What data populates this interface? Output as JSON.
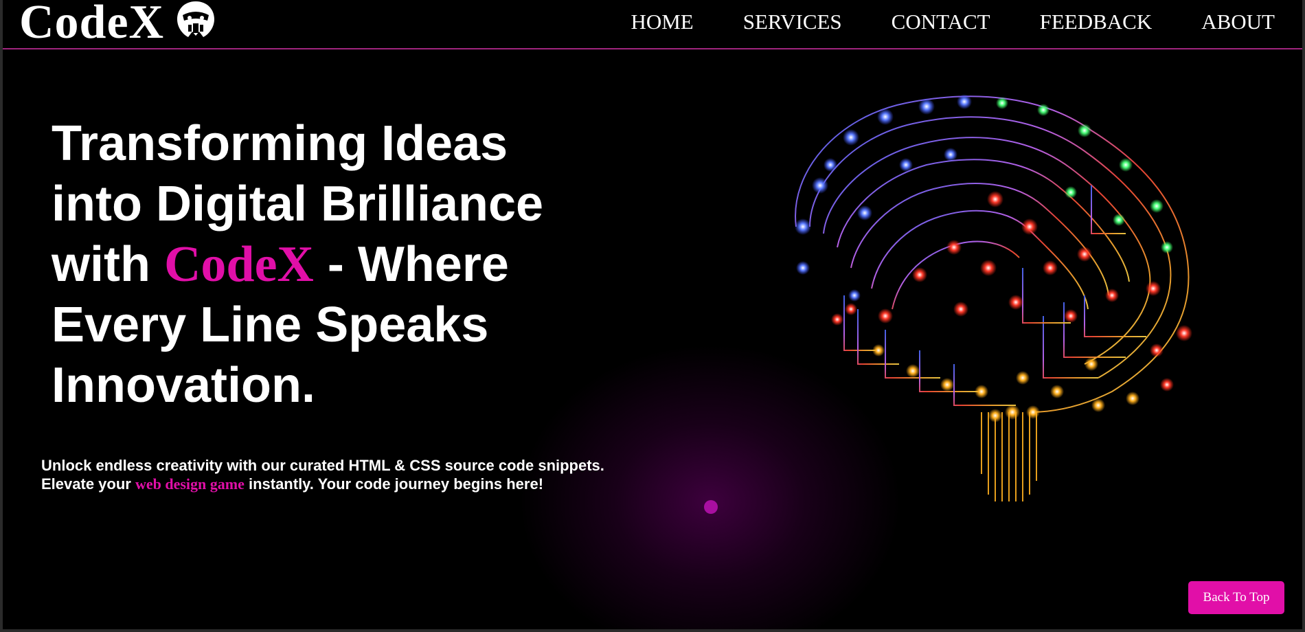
{
  "nav": {
    "logo": "CodeX",
    "logo_icon": "hacker-mask-icon",
    "links": [
      "HOME",
      "SERVICES",
      "CONTACT",
      "FEEDBACK",
      "ABOUT"
    ]
  },
  "hero": {
    "headline_1": "Transforming Ideas into Digital Brilliance with ",
    "headline_brand": "CodeX",
    "headline_2": " - Where Every Line Speaks Innovation.",
    "para_1": "Unlock endless creativity with our curated HTML & CSS source code snippets. Elevate your ",
    "para_highlight": "web design game",
    "para_2": " instantly. Your code journey begins here!",
    "image": "circuit-brain-illustration"
  },
  "back_to_top": "Back To Top",
  "colors": {
    "accent": "#e10fa8",
    "background": "#000000",
    "nav_border": "#a0257f"
  }
}
